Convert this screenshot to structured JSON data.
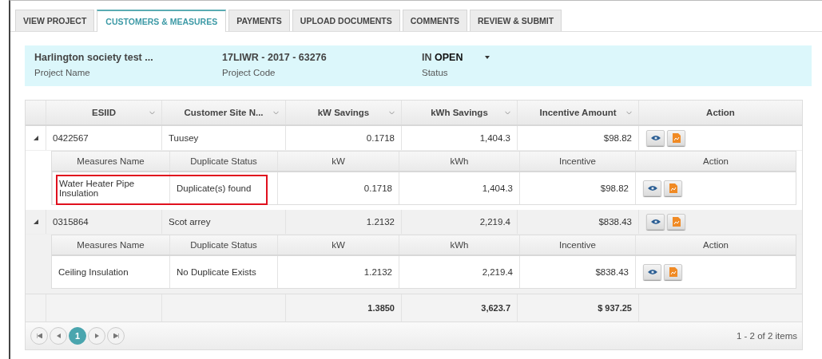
{
  "tabs": [
    {
      "label": "VIEW PROJECT",
      "selected": false
    },
    {
      "label": "CUSTOMERS & MEASURES",
      "selected": true
    },
    {
      "label": "PAYMENTS",
      "selected": false
    },
    {
      "label": "UPLOAD DOCUMENTS",
      "selected": false
    },
    {
      "label": "COMMENTS",
      "selected": false
    },
    {
      "label": "REVIEW & SUBMIT",
      "selected": false
    }
  ],
  "project": {
    "fields": [
      {
        "value": "Harlington society test ...",
        "label": "Project Name"
      },
      {
        "value": "17LIWR - 2017 - 63276",
        "label": "Project Code"
      },
      {
        "value": "IN **OPEN**",
        "label": "Status",
        "kind": "dropdown"
      }
    ]
  },
  "grid": {
    "columns": [
      "ESIID",
      "Customer Site N...",
      "kW Savings",
      "kWh Savings",
      "Incentive Amount",
      "Action"
    ],
    "rows": [
      {
        "esiid": "0422567",
        "site": "Tuusey",
        "kw": "0.1718",
        "kwh": "1,404.3",
        "incentive": "$98.82",
        "expanded": true,
        "detail_columns": [
          "Measures Name",
          "Duplicate Status",
          "kW",
          "kWh",
          "Incentive",
          "Action"
        ],
        "measures": [
          {
            "name": "Water Heater Pipe Insulation",
            "duplicate": "Duplicate(s) found",
            "kw": "0.1718",
            "kwh": "1,404.3",
            "incentive": "$98.82",
            "highlighted": true
          }
        ]
      },
      {
        "esiid": "0315864",
        "site": "Scot arrey",
        "kw": "1.2132",
        "kwh": "2,219.4",
        "incentive": "$838.43",
        "expanded": true,
        "detail_columns": [
          "Measures Name",
          "Duplicate Status",
          "kW",
          "kWh",
          "Incentive",
          "Action"
        ],
        "measures": [
          {
            "name": "Ceiling Insulation",
            "duplicate": "No Duplicate Exists",
            "kw": "1.2132",
            "kwh": "2,219.4",
            "incentive": "$838.43",
            "highlighted": false
          }
        ]
      }
    ],
    "totals": {
      "kw": "1.3850",
      "kwh": "3,623.7",
      "incentive": "$ 937.25"
    },
    "pager": {
      "pages": [
        {
          "label": "1",
          "selected": true
        }
      ],
      "info": "1 - 2 of 2 items"
    }
  }
}
